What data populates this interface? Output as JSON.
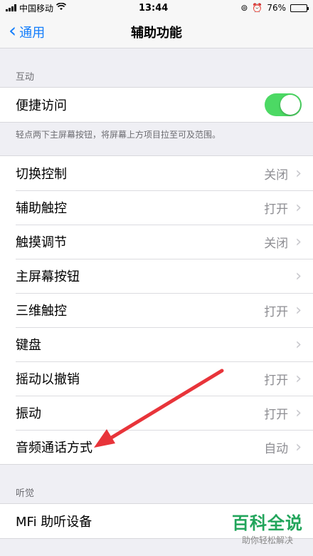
{
  "status": {
    "carrier": "中国移动",
    "time": "13:44",
    "battery": "76%",
    "battery_level": 0.76
  },
  "nav": {
    "back_label": "通用",
    "title": "辅助功能"
  },
  "interaction": {
    "header": "互动",
    "reachability": {
      "label": "便捷访问",
      "on": true
    },
    "footnote": "轻点两下主屏幕按钮，将屏幕上方项目拉至可及范围。"
  },
  "settings": [
    {
      "label": "切换控制",
      "value": "关闭"
    },
    {
      "label": "辅助触控",
      "value": "打开"
    },
    {
      "label": "触摸调节",
      "value": "关闭"
    },
    {
      "label": "主屏幕按钮",
      "value": ""
    },
    {
      "label": "三维触控",
      "value": "打开"
    },
    {
      "label": "键盘",
      "value": ""
    },
    {
      "label": "摇动以撤销",
      "value": "打开"
    },
    {
      "label": "振动",
      "value": "打开"
    },
    {
      "label": "音频通话方式",
      "value": "自动"
    }
  ],
  "hearing": {
    "header": "听觉",
    "items": [
      {
        "label": "MFi 助听设备"
      }
    ]
  },
  "watermark": {
    "main": "百科全说",
    "sub": "助你轻松解决"
  },
  "colors": {
    "accent": "#157efb",
    "toggle_on": "#4cd964",
    "annotation_arrow": "#e8343a",
    "watermark": "#22a55b"
  }
}
